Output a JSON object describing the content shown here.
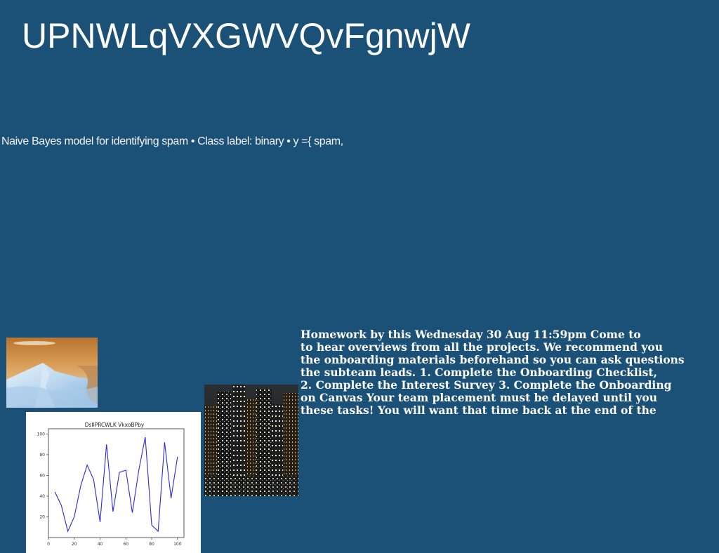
{
  "page": {
    "title": "UPNWLqVXGWVQvFgnwjW",
    "subtitle": "Naive Bayes model for identifying spam • Class label: binary • y ={ spam,",
    "body_lines": [
      "Homework by this Wednesday 30 Aug 11:59pm Come to",
      "to hear overviews from all the projects. We recommend you",
      "the onboarding materials beforehand so you can ask questions",
      "the subteam leads. 1. Complete the Onboarding Checklist,",
      "2. Complete the Interest Survey 3. Complete the Onboarding",
      "on Canvas Your team placement must be delayed until you",
      "these tasks! You will want that time back at the end of the"
    ]
  },
  "colors": {
    "background": "#1b5077",
    "line": "#2a2ae0"
  },
  "chart_data": {
    "type": "line",
    "title": "DsIlPRCWLK VkxoBPby",
    "x": [
      5,
      10,
      15,
      20,
      25,
      30,
      35,
      40,
      45,
      50,
      55,
      60,
      65,
      70,
      75,
      80,
      85,
      90,
      95,
      100
    ],
    "series": [
      {
        "values": [
          44,
          31,
          6,
          20,
          50,
          70,
          56,
          15,
          90,
          25,
          63,
          65,
          24,
          65,
          97,
          12,
          6,
          92,
          38,
          78
        ]
      }
    ],
    "xlim": [
      0,
      105
    ],
    "ylim": [
      0,
      105
    ],
    "xticks": [
      0,
      20,
      40,
      60,
      80,
      100
    ],
    "yticks": [
      20,
      40,
      60,
      80,
      100
    ],
    "grid": false
  }
}
